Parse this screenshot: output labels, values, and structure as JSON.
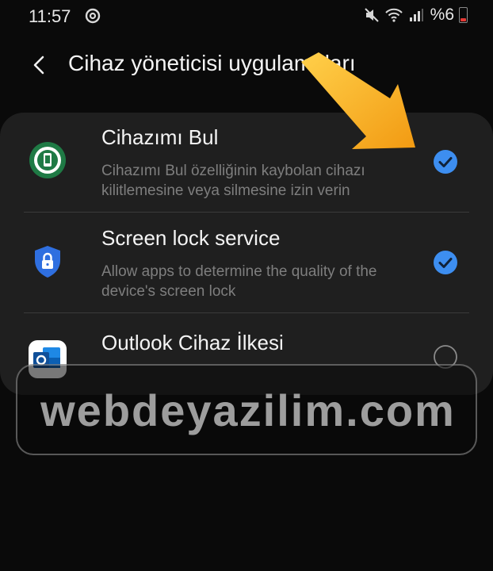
{
  "status_bar": {
    "time": "11:57",
    "battery_percent": "%6",
    "icons": [
      "sync-icon",
      "mute-icon",
      "wifi-icon",
      "signal-icon",
      "battery-icon"
    ],
    "battery_color": "#e53935"
  },
  "header": {
    "title": "Cihaz yöneticisi uygulamaları",
    "back_icon": "back-arrow-icon"
  },
  "apps": [
    {
      "name": "Cihazımı Bul",
      "description": "Cihazımı Bul özelliğinin kaybolan cihazı kilitlemesine veya silmesine izin verin",
      "icon": "find-my-device-icon",
      "enabled": true
    },
    {
      "name": "Screen lock service",
      "description": "Allow apps to determine the quality of the device's screen lock",
      "icon": "shield-lock-icon",
      "enabled": true
    },
    {
      "name": "Outlook Cihaz İlkesi",
      "description": "",
      "icon": "outlook-icon",
      "enabled": false
    }
  ],
  "watermark": {
    "text": "webdeyazilim.com"
  },
  "colors": {
    "accent": "#3d8ef0",
    "card_background": "#1f1f1f",
    "annotation_arrow": "#f6a21a"
  }
}
